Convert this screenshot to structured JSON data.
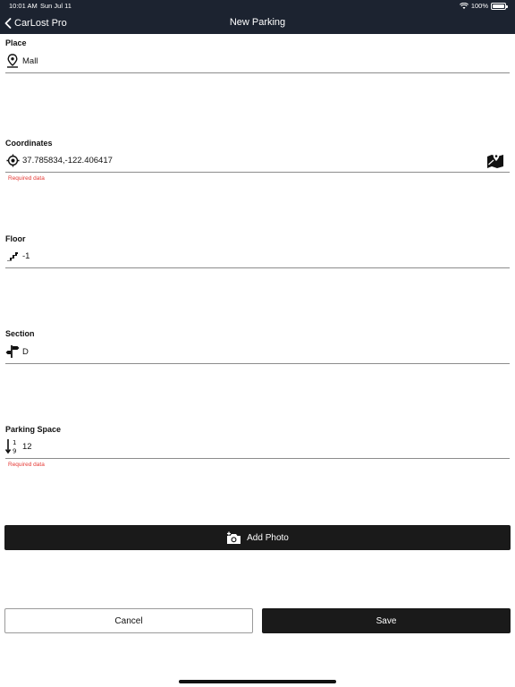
{
  "status": {
    "time": "10:01 AM",
    "date": "Sun Jul 11",
    "battery": "100%"
  },
  "nav": {
    "back_label": "CarLost Pro",
    "title": "New Parking"
  },
  "fields": {
    "place": {
      "label": "Place",
      "value": "Mall",
      "icon": "map-pin-icon"
    },
    "coordinates": {
      "label": "Coordinates",
      "value": "37.785834,-122.406417",
      "icon": "crosshair-icon",
      "error": "Required data",
      "action_icon": "map-icon"
    },
    "floor": {
      "label": "Floor",
      "value": "-1",
      "icon": "stairs-icon"
    },
    "section": {
      "label": "Section",
      "value": "D",
      "icon": "signpost-icon"
    },
    "parking_space": {
      "label": "Parking Space",
      "value": "12",
      "icon": "number-sort-icon",
      "error": "Required data"
    }
  },
  "actions": {
    "add_photo": "Add Photo",
    "cancel": "Cancel",
    "save": "Save"
  },
  "colors": {
    "nav_bg": "#1c2330",
    "button_dark": "#1a1a1a",
    "error": "#e53935"
  }
}
